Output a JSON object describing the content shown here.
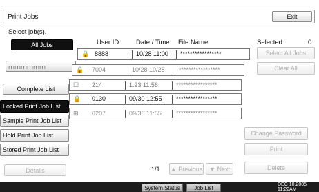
{
  "window": {
    "title": "Print Jobs",
    "exit_label": "Exit"
  },
  "prompt": "Select job(s).",
  "selected": {
    "label": "Selected:",
    "count": "0"
  },
  "headers": {
    "user_id": "User ID",
    "date_time": "Date / Time",
    "file_name": "File Name"
  },
  "filter_buttons": {
    "all_jobs": "All Jobs",
    "blurred_mode": "ｍｍｍｍｍｍ",
    "complete_list": "Complete List",
    "locked_list": "Locked Print Job List",
    "sample_list": "Sample Print Job List",
    "hold_list": "Hold Print Job List",
    "stored_list": "Stored Print Job List",
    "details": "Details"
  },
  "jobs": [
    {
      "icon": "🔒",
      "user": "8888",
      "datetime": "10/28 11:00",
      "file": "*****************"
    },
    {
      "icon": "🔒",
      "user": "7004",
      "datetime": "10/28 10/28",
      "file": "*****************"
    },
    {
      "icon": "☐",
      "user": "214",
      "datetime": "1.23 11:56",
      "file": "*****************"
    },
    {
      "icon": "🔒",
      "user": "0130",
      "datetime": "09/30 12:55",
      "file": "*****************"
    },
    {
      "icon": "⊞",
      "user": "0207",
      "datetime": "09/30 11:55",
      "file": "*****************"
    }
  ],
  "right_buttons": {
    "select_all": "Select All Jobs",
    "clear_all": "Clear All",
    "change_password": "Change Password",
    "print": "Print",
    "delete": "Delete"
  },
  "pager": {
    "page": "1/1",
    "previous": "▲ Previous",
    "next": "▼ Next"
  },
  "footer": {
    "system_status": "System Status",
    "job_list": "Job List",
    "date": "DEC  10,2005",
    "time": "11:22AM"
  }
}
